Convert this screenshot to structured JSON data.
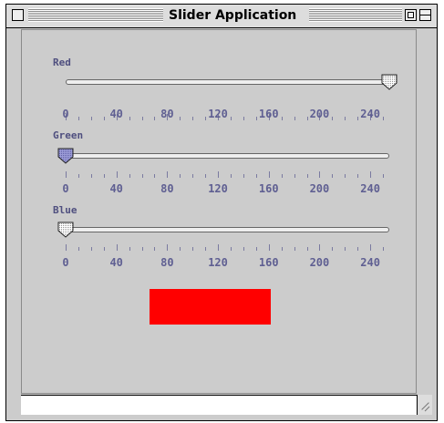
{
  "window": {
    "title": "Slider Application"
  },
  "scale": {
    "min": 0,
    "max": 255,
    "tick_labels": [
      "0",
      "40",
      "80",
      "120",
      "160",
      "200",
      "240"
    ]
  },
  "sliders": [
    {
      "label": "Red",
      "value": 255,
      "thumb_style": "dotted"
    },
    {
      "label": "Green",
      "value": 0,
      "thumb_style": "active"
    },
    {
      "label": "Blue",
      "value": 0,
      "thumb_style": "dotted"
    }
  ],
  "swatch": {
    "color": "#ff0000"
  }
}
